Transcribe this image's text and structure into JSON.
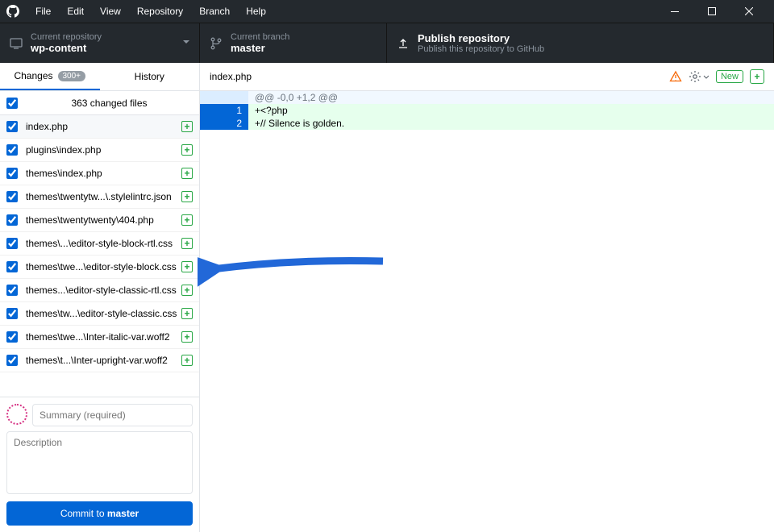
{
  "menu": [
    "File",
    "Edit",
    "View",
    "Repository",
    "Branch",
    "Help"
  ],
  "repo": {
    "label": "Current repository",
    "value": "wp-content"
  },
  "branch": {
    "label": "Current branch",
    "value": "master"
  },
  "publish": {
    "title": "Publish repository",
    "subtitle": "Publish this repository to GitHub"
  },
  "tabs": {
    "changes": "Changes",
    "badge": "300+",
    "history": "History"
  },
  "changed_summary": "363 changed files",
  "files": [
    {
      "name": "index.php",
      "sel": true
    },
    {
      "name": "plugins\\index.php"
    },
    {
      "name": "themes\\index.php"
    },
    {
      "name": "themes\\twentytw...\\.stylelintrc.json"
    },
    {
      "name": "themes\\twentytwenty\\404.php"
    },
    {
      "name": "themes\\...\\editor-style-block-rtl.css"
    },
    {
      "name": "themes\\twe...\\editor-style-block.css"
    },
    {
      "name": "themes...\\editor-style-classic-rtl.css"
    },
    {
      "name": "themes\\tw...\\editor-style-classic.css"
    },
    {
      "name": "themes\\twe...\\Inter-italic-var.woff2"
    },
    {
      "name": "themes\\t...\\Inter-upright-var.woff2"
    }
  ],
  "commit": {
    "summary_ph": "Summary (required)",
    "desc_ph": "Description",
    "btn_prefix": "Commit to ",
    "btn_branch": "master"
  },
  "open_file": "index.php",
  "toolbar": {
    "new": "New"
  },
  "diff": {
    "hunk": "@@ -0,0 +1,2 @@",
    "lines": [
      {
        "n": "1",
        "t": "+<?php"
      },
      {
        "n": "2",
        "t": "+// Silence is golden."
      }
    ]
  }
}
